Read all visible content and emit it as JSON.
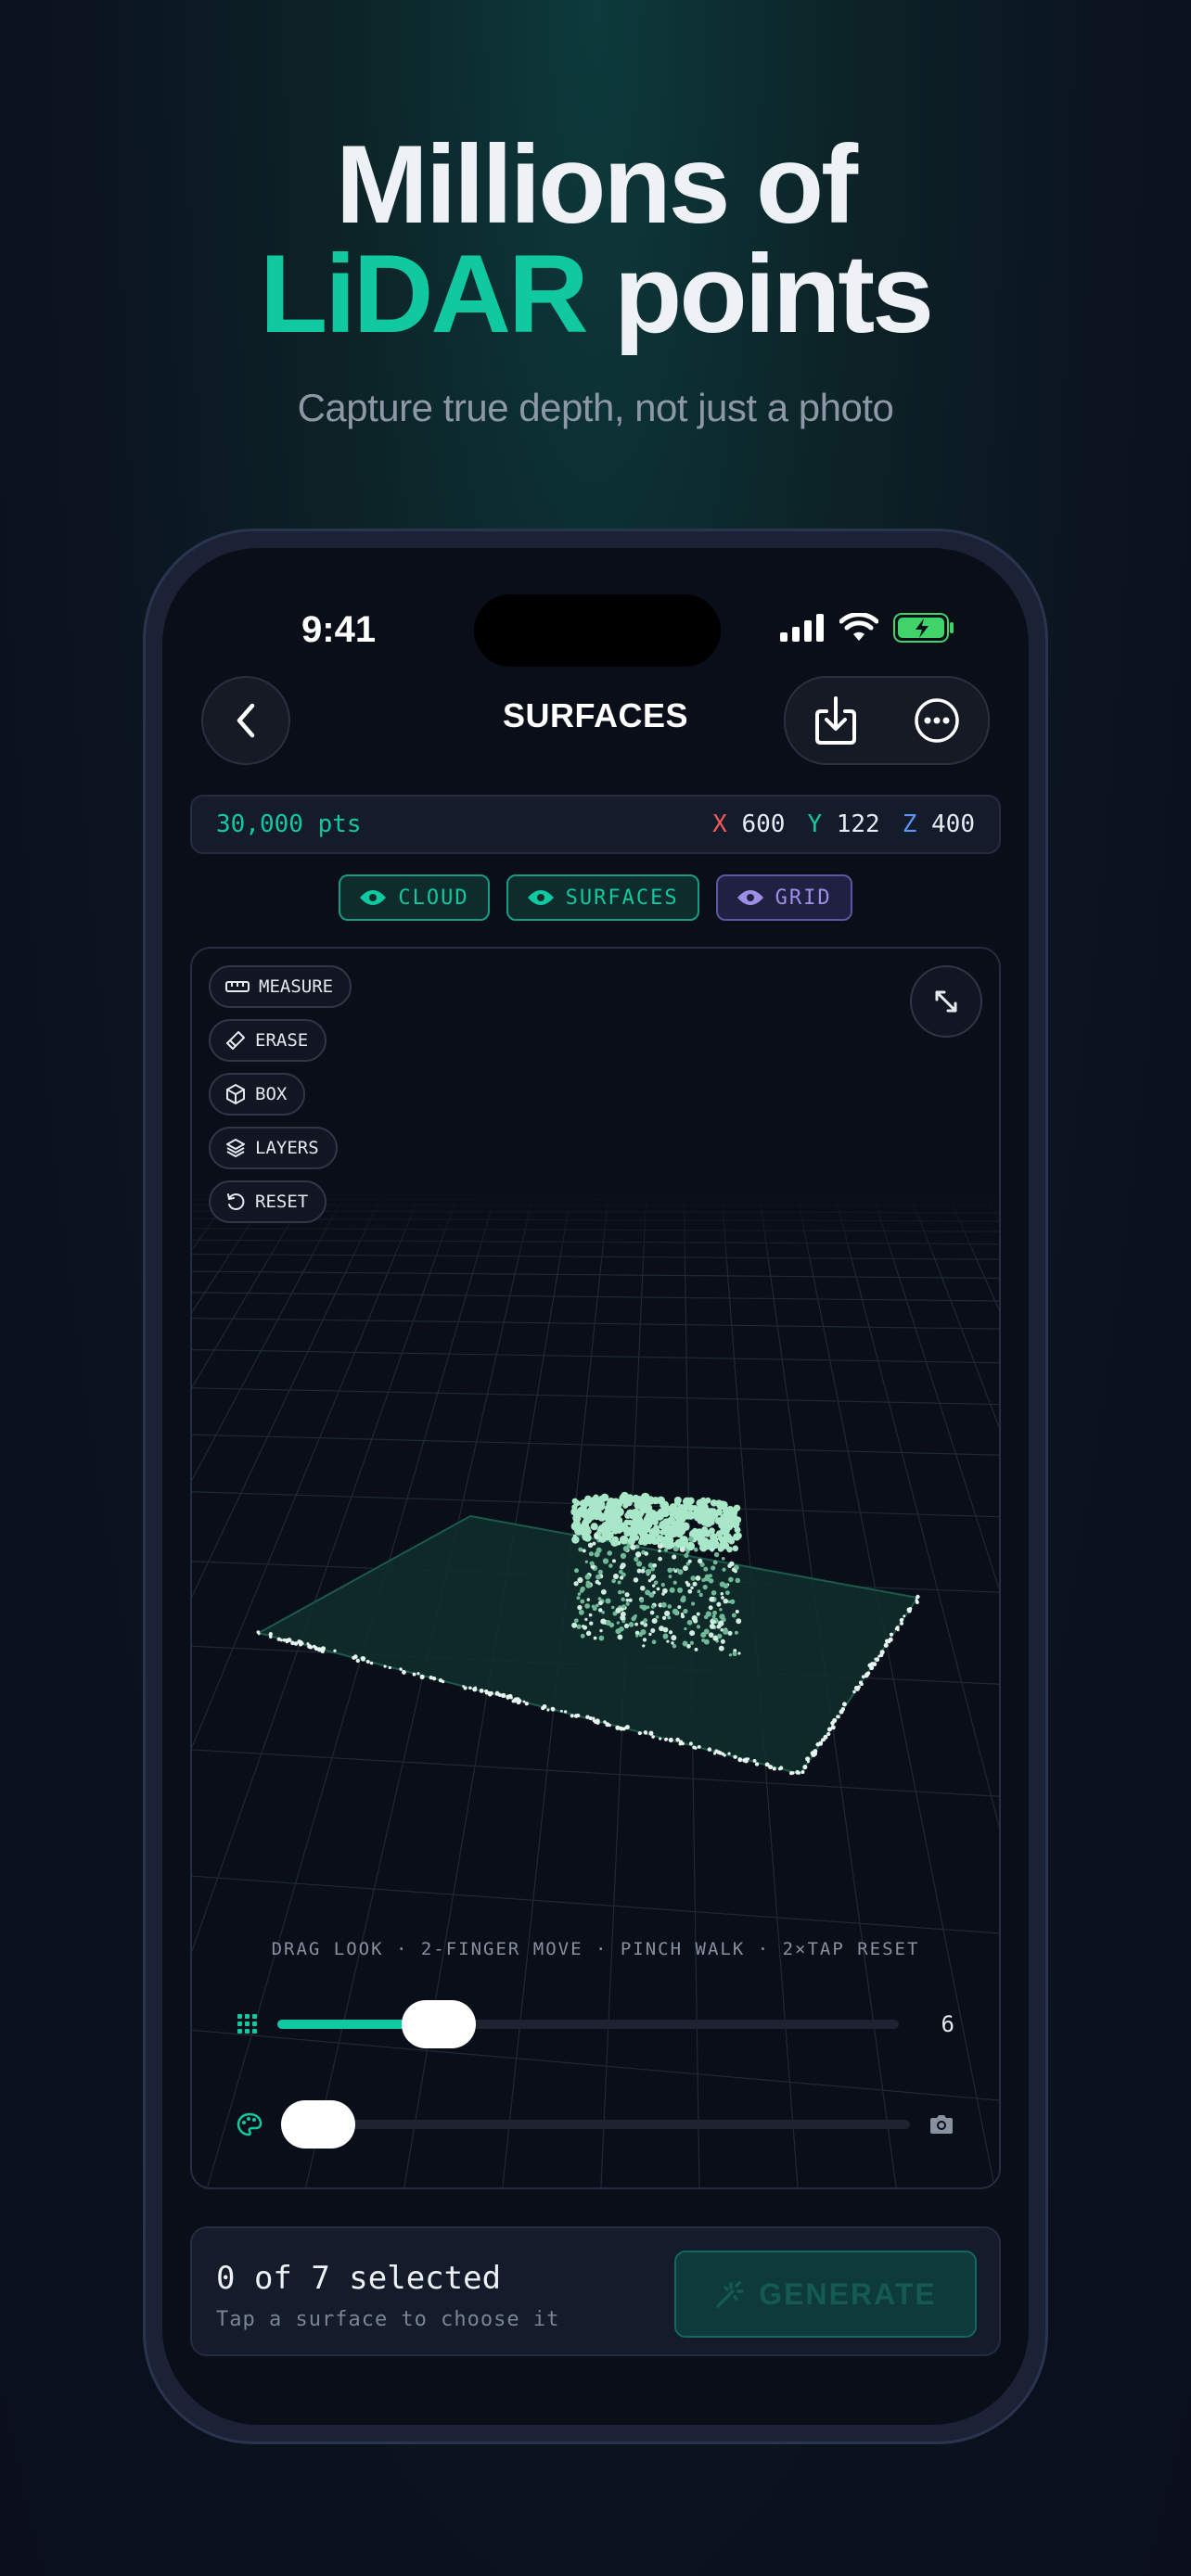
{
  "hero": {
    "line1": "Millions of",
    "accent": "LiDAR",
    "line2_rest": " points",
    "subtitle": "Capture true depth, not just a photo"
  },
  "status_bar": {
    "time": "9:41"
  },
  "nav": {
    "title": "SURFACES"
  },
  "coords": {
    "points": "30,000 pts",
    "x_label": "X",
    "x_value": "600",
    "y_label": "Y",
    "y_value": "122",
    "z_label": "Z",
    "z_value": "400"
  },
  "layer_chips": [
    {
      "label": "CLOUD"
    },
    {
      "label": "SURFACES"
    },
    {
      "label": "GRID"
    }
  ],
  "tools": [
    {
      "label": "MEASURE",
      "icon": "ruler-icon"
    },
    {
      "label": "ERASE",
      "icon": "eraser-icon"
    },
    {
      "label": "BOX",
      "icon": "cube-icon"
    },
    {
      "label": "LAYERS",
      "icon": "layers-icon"
    },
    {
      "label": "RESET",
      "icon": "reset-icon"
    }
  ],
  "viewport": {
    "hint": "DRAG LOOK · 2-FINGER MOVE · PINCH WALK · 2×TAP RESET"
  },
  "sliders": {
    "point_size": {
      "value": "6",
      "fraction": 0.26,
      "icon": "grid-dots-icon"
    },
    "color": {
      "fraction": 0.0,
      "icon": "palette-icon",
      "end_icon": "camera-icon"
    }
  },
  "selection": {
    "count": "0 of 7 selected",
    "hint": "Tap a surface to choose it",
    "generate_label": "GENERATE"
  },
  "colors": {
    "accent": "#10c9a0",
    "x_axis": "#f05a5a",
    "y_axis": "#10c9a0",
    "z_axis": "#5a94f0",
    "grid_chip": "#9d8fe6"
  }
}
